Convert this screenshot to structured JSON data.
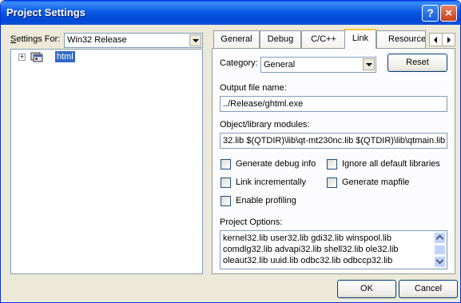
{
  "window": {
    "title": "Project Settings",
    "help_label": "?",
    "close_label": "×"
  },
  "left": {
    "settings_for_prefix": "S",
    "settings_for_rest": "ettings For:",
    "settings_for_value": "Win32 Release",
    "tree": {
      "expander": "+",
      "item_label": "html"
    }
  },
  "tabs": [
    {
      "label": "General"
    },
    {
      "label": "Debug"
    },
    {
      "label": "C/C++"
    },
    {
      "label": "Link"
    },
    {
      "label": "Resources"
    }
  ],
  "active_tab": "Link",
  "link": {
    "category_label": "Category:",
    "category_value": "General",
    "reset_label": "Reset",
    "output_file_label": "Output file name:",
    "output_file_value": "../Release/ghtml.exe",
    "modules_label": "Object/library modules:",
    "modules_value": "32.lib $(QTDIR)\\lib\\qt-mt230nc.lib $(QTDIR)\\lib\\qtmain.lib",
    "checkboxes": [
      {
        "label": "Generate debug info",
        "checked": false
      },
      {
        "label": "Ignore all default libraries",
        "checked": false
      },
      {
        "label": "Link incrementally",
        "checked": false
      },
      {
        "label": "Generate mapfile",
        "checked": false
      },
      {
        "label": "Enable profiling",
        "checked": false
      }
    ],
    "project_options_label": "Project Options:",
    "project_options_lines": [
      "kernel32.lib user32.lib gdi32.lib winspool.lib",
      "comdlg32.lib advapi32.lib shell32.lib ole32.lib",
      "oleaut32.lib uuid.lib odbc32.lib odbccp32.lib"
    ]
  },
  "footer": {
    "ok_label": "OK",
    "cancel_label": "Cancel"
  },
  "colors": {
    "titlebar": "#0b5be6",
    "dialog_bg": "#ece9d8",
    "selection": "#316ac5",
    "active_tab_accent": "#ffc83c"
  }
}
